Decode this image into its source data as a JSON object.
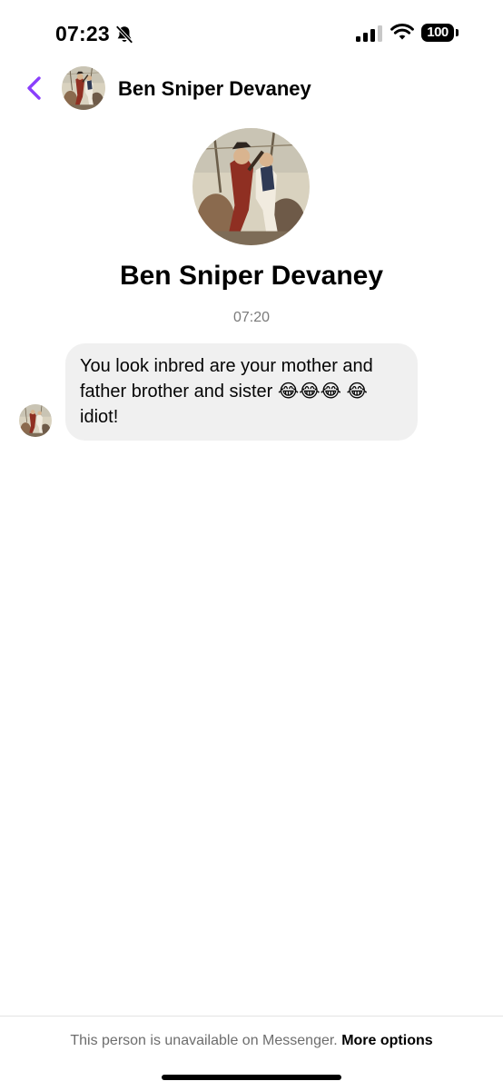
{
  "status_bar": {
    "time": "07:23",
    "battery_level": "100",
    "icons": [
      "bell-slash-icon",
      "cellular-signal-icon",
      "wifi-icon",
      "battery-icon"
    ]
  },
  "header": {
    "back_icon": "chevron-left-icon",
    "title": "Ben Sniper Devaney"
  },
  "profile": {
    "name": "Ben Sniper Devaney"
  },
  "conversation": {
    "timestamp": "07:20",
    "messages": [
      {
        "sender": "Ben Sniper Devaney",
        "text": "You look inbred are your mother and father brother and sister 😂😂😂 😂 idiot!"
      }
    ]
  },
  "footer": {
    "notice": "This person is unavailable on Messenger.",
    "link": "More options"
  },
  "colors": {
    "accent": "#8a3ffc",
    "bubble_background": "#f0f0f0",
    "muted_text": "#7a7a7a",
    "background": "#ffffff"
  }
}
